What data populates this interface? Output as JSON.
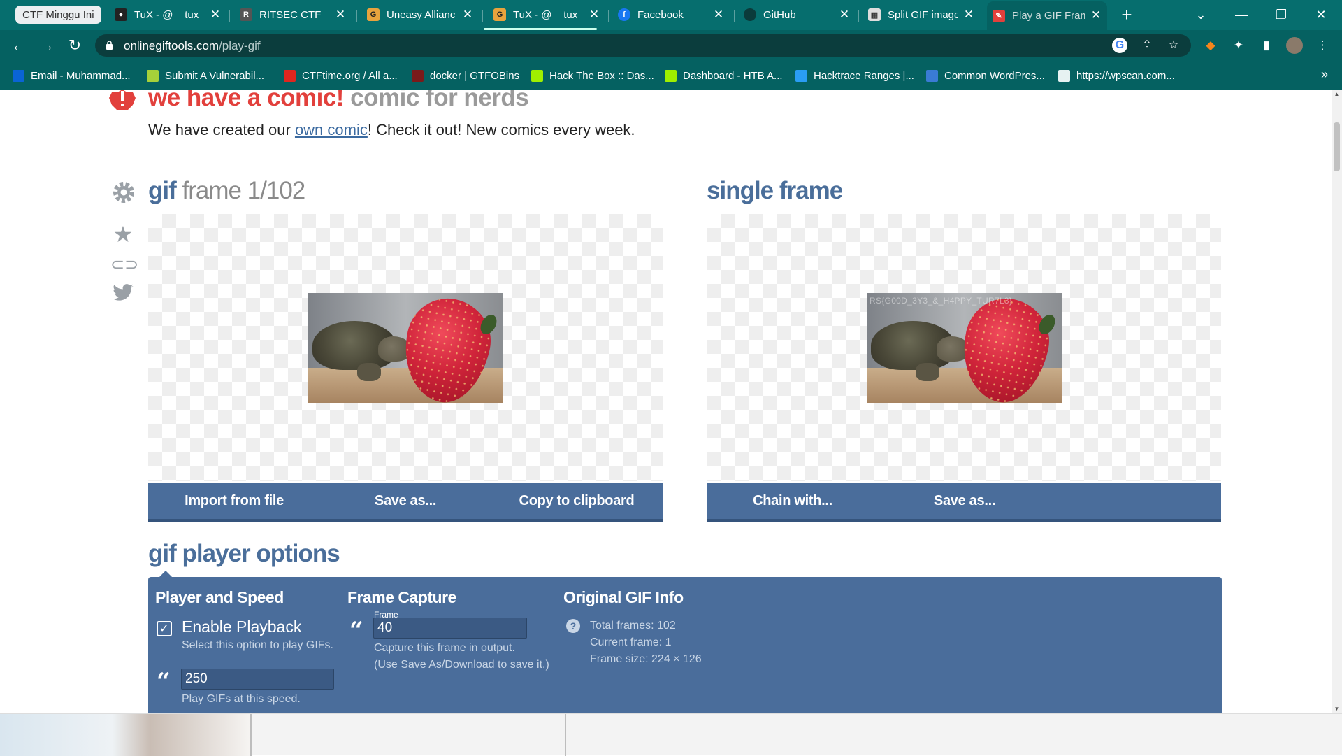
{
  "browser": {
    "tabs": [
      {
        "label": "CTF Minggu Ini",
        "kind": "group"
      },
      {
        "label": "TuX - @__tux",
        "icon": "tux-icon"
      },
      {
        "label": "RITSEC CTF",
        "icon": "ritsec-icon"
      },
      {
        "label": "Uneasy Allianc",
        "icon": "g-icon"
      },
      {
        "label": "TuX - @__tux",
        "icon": "g-icon"
      },
      {
        "label": "Facebook",
        "icon": "facebook-icon"
      },
      {
        "label": "GitHub",
        "icon": "github-icon"
      },
      {
        "label": "Split GIF image",
        "icon": "split-gif-icon"
      },
      {
        "label": "Play a GIF Fram",
        "icon": "onlinegiftools-icon",
        "active": true
      }
    ],
    "new_tab": "+",
    "window": {
      "tab_search": "⌄",
      "minimize": "—",
      "restore": "❐",
      "close": "✕"
    },
    "tab_close": "✕",
    "url_host": "onlinegiftools.com",
    "url_path": "/play-gif",
    "bookmarks": [
      {
        "label": "Email - Muhammad...",
        "color": "#0a64d6"
      },
      {
        "label": "Submit A Vulnerabil...",
        "color": "#a6d13a"
      },
      {
        "label": "CTFtime.org / All a...",
        "color": "#e0261f"
      },
      {
        "label": "docker | GTFOBins",
        "color": "#7a1a1a"
      },
      {
        "label": "Hack The Box :: Das...",
        "color": "#9fef00"
      },
      {
        "label": "Dashboard - HTB A...",
        "color": "#9fef00"
      },
      {
        "label": "Hacktrace Ranges |...",
        "color": "#2a9df4"
      },
      {
        "label": "Common WordPres...",
        "color": "#3a7bd5"
      },
      {
        "label": "https://wpscan.com...",
        "color": "#e6f2f2"
      }
    ],
    "bookmarks_more": "»"
  },
  "page": {
    "comic": {
      "title_red": "we have a comic!",
      "title_grey": "comic for nerds",
      "text_before": "We have created our ",
      "link": "own comic",
      "text_after": "! Check it out! New comics every week."
    },
    "left_tool": {
      "title_main": "gif",
      "title_rest": " frame 1/102",
      "buttons": [
        "Import from file",
        "Save as...",
        "Copy to clipboard"
      ]
    },
    "right_tool": {
      "title": "single frame",
      "buttons": [
        "Chain with...",
        "Save as..."
      ],
      "image_overlay_text": "RS{G00D_3Y3_&_H4PPY_TUR7L3}"
    },
    "options": {
      "title": "gif player options",
      "player": {
        "heading": "Player and Speed",
        "enable_label": "Enable Playback",
        "enable_help": "Select this option to play GIFs.",
        "enabled": true,
        "speed_value": "250",
        "speed_help": "Play GIFs at this speed."
      },
      "capture": {
        "heading": "Frame Capture",
        "caption": "Frame",
        "frame_value": "40",
        "help_line1": "Capture this frame in output.",
        "help_line2": "(Use Save As/Download to save it.)"
      },
      "info": {
        "heading": "Original GIF Info",
        "total": "Total frames: 102",
        "current": "Current frame: 1",
        "size": "Frame size: 224 × 126"
      }
    }
  }
}
